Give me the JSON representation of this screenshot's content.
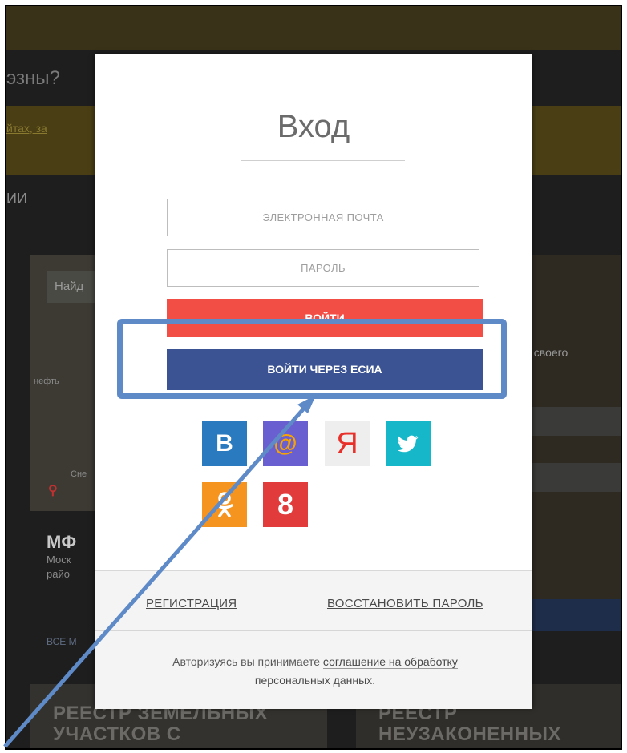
{
  "background": {
    "question_fragment": "эзны?",
    "yellow_link_fragment": "йтах, за",
    "nav_fragment": "ИИ",
    "map_search_fragment": "Найд",
    "map_label_oil": "нефть",
    "map_label_bottom": "Сне",
    "right_text": "ок своего",
    "mf_title": "МФ",
    "mf_sub": "Моск райо",
    "all_link": "ВСЕ М",
    "card_left_title": "РЕЕСТР ЗЕМЕЛЬНЫХ УЧАСТКОВ С",
    "card_right_title": "РЕЕСТР НЕУЗАКОНЕННЫХ"
  },
  "modal": {
    "title": "Вход",
    "email_placeholder": "ЭЛЕКТРОННАЯ ПОЧТА",
    "password_placeholder": "ПАРОЛЬ",
    "login_label": "ВОЙТИ",
    "esia_label": "ВОЙТИ ЧЕРЕЗ ЕСИА",
    "social": {
      "vk": "B",
      "mail": "@",
      "yandex": "Я",
      "twitter": "🐦",
      "ok": "ok",
      "google": "8"
    },
    "register_link": "РЕГИСТРАЦИЯ",
    "restore_link": "ВОССТАНОВИТЬ ПАРОЛЬ",
    "consent_prefix": "Авторизуясь вы принимаете ",
    "consent_link": "соглашение на обработку персональных данных",
    "consent_suffix": "."
  },
  "colors": {
    "login_button": "#f34e45",
    "esia_button": "#3b5392",
    "annotation": "#5e8ac7"
  }
}
